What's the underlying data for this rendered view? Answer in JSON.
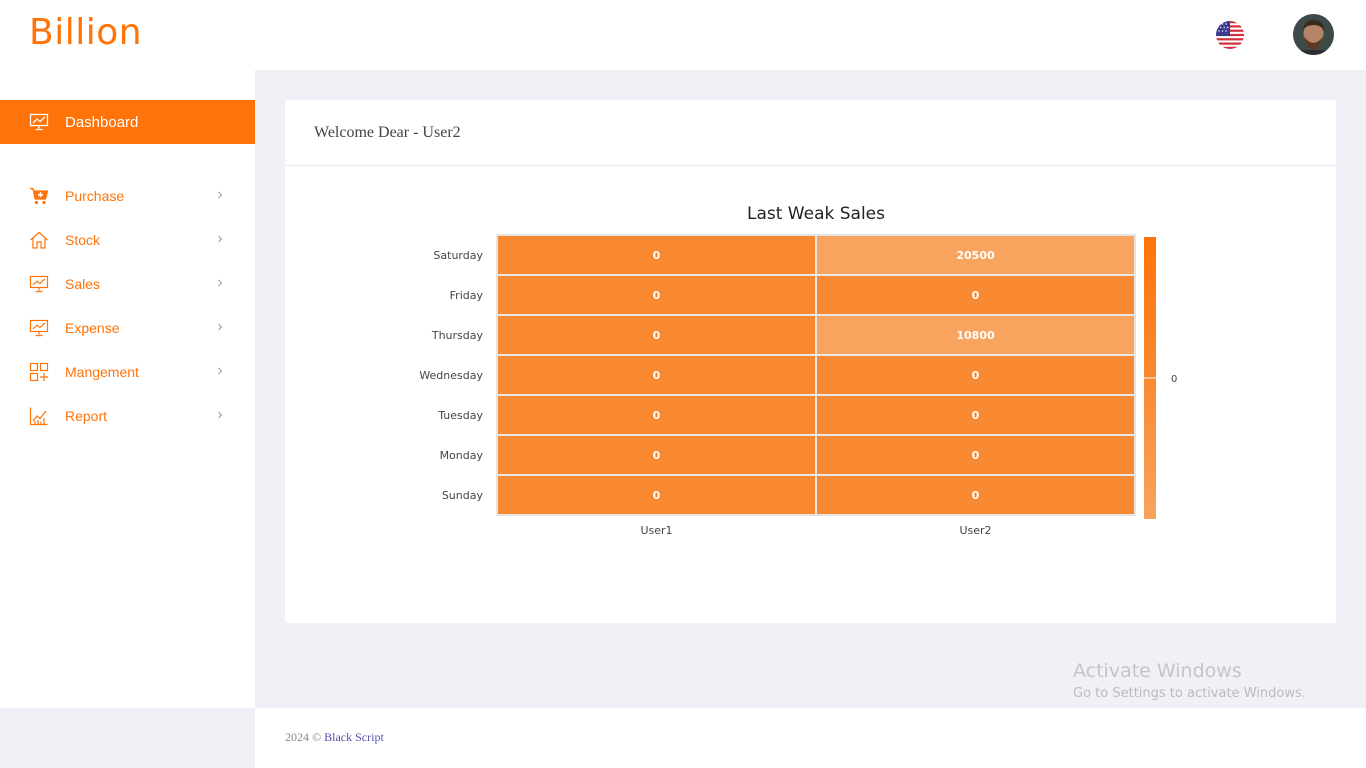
{
  "app": {
    "logo": "Billion"
  },
  "sidebar": {
    "active": {
      "label": "Dashboard",
      "icon": "presentation-chart-icon"
    },
    "items": [
      {
        "label": "Purchase",
        "icon": "cart-plus-icon"
      },
      {
        "label": "Stock",
        "icon": "home-icon"
      },
      {
        "label": "Sales",
        "icon": "presentation-chart-icon"
      },
      {
        "label": "Expense",
        "icon": "presentation-chart-icon"
      },
      {
        "label": "Mangement",
        "icon": "grid-plus-icon"
      },
      {
        "label": "Report",
        "icon": "line-chart-icon"
      }
    ]
  },
  "header": {
    "flag_icon": "us-flag-icon",
    "avatar_icon": "user-avatar"
  },
  "card": {
    "title": "Welcome Dear - User2"
  },
  "chart_data": {
    "type": "heatmap",
    "title": "Last Weak Sales",
    "x": [
      "User1",
      "User2"
    ],
    "y": [
      "Saturday",
      "Friday",
      "Thursday",
      "Wednesday",
      "Tuesday",
      "Monday",
      "Sunday"
    ],
    "values": [
      [
        0,
        20500
      ],
      [
        0,
        0
      ],
      [
        0,
        10800
      ],
      [
        0,
        0
      ],
      [
        0,
        0
      ],
      [
        0,
        0
      ],
      [
        0,
        0
      ]
    ],
    "colorbar": {
      "tick_label": "0"
    },
    "colors": {
      "high": "#f8a35e",
      "low": "#f98931",
      "bar_top": "#ff7308",
      "bar_bottom": "#f8a35e"
    }
  },
  "footer": {
    "text": "2024 ©",
    "link": "Black Script"
  },
  "watermark": {
    "title": "Activate Windows",
    "subtitle": "Go to Settings to activate Windows."
  },
  "colors": {
    "accent": "#ff7308",
    "background": "#f0f1f6"
  }
}
